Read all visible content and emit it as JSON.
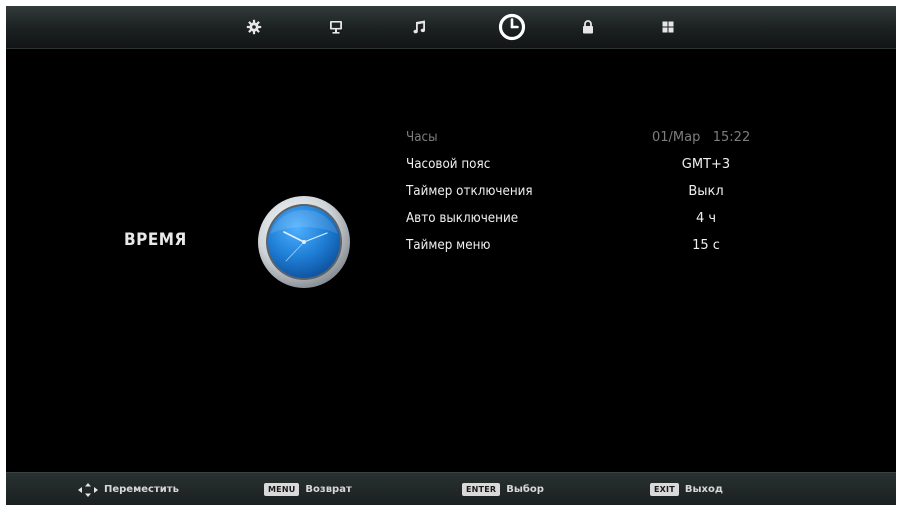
{
  "tabs": [
    {
      "icon": "gear-icon",
      "active": false
    },
    {
      "icon": "monitor-icon",
      "active": false
    },
    {
      "icon": "music-note-icon",
      "active": false
    },
    {
      "icon": "clock-icon",
      "active": true
    },
    {
      "icon": "lock-icon",
      "active": false
    },
    {
      "icon": "apps-grid-icon",
      "active": false
    }
  ],
  "page": {
    "title": "ВРЕМЯ",
    "illustration_icon": "analog-clock-icon"
  },
  "settings": [
    {
      "label": "Часы",
      "value": "01/Мар   15:22",
      "enabled": false
    },
    {
      "label": "Часовой пояс",
      "value": "GMT+3",
      "enabled": true
    },
    {
      "label": "Таймер отключения",
      "value": "Выкл",
      "enabled": true
    },
    {
      "label": "Авто выключение",
      "value": "4 ч",
      "enabled": true
    },
    {
      "label": "Таймер меню",
      "value": "15 с",
      "enabled": true
    }
  ],
  "hints": {
    "move": {
      "icon": "arrows-icon",
      "label": "Переместить"
    },
    "menu": {
      "key": "MENU",
      "label": "Возврат"
    },
    "enter": {
      "key": "ENTER",
      "label": "Выбор"
    },
    "exit": {
      "key": "EXIT",
      "label": "Выход"
    }
  },
  "colors": {
    "background": "#000000",
    "active_tab": "#ffffff",
    "inactive_tab": "#e6e6e6",
    "disabled_text": "#7d7d7d",
    "clock_face": "#1f7fd6"
  }
}
